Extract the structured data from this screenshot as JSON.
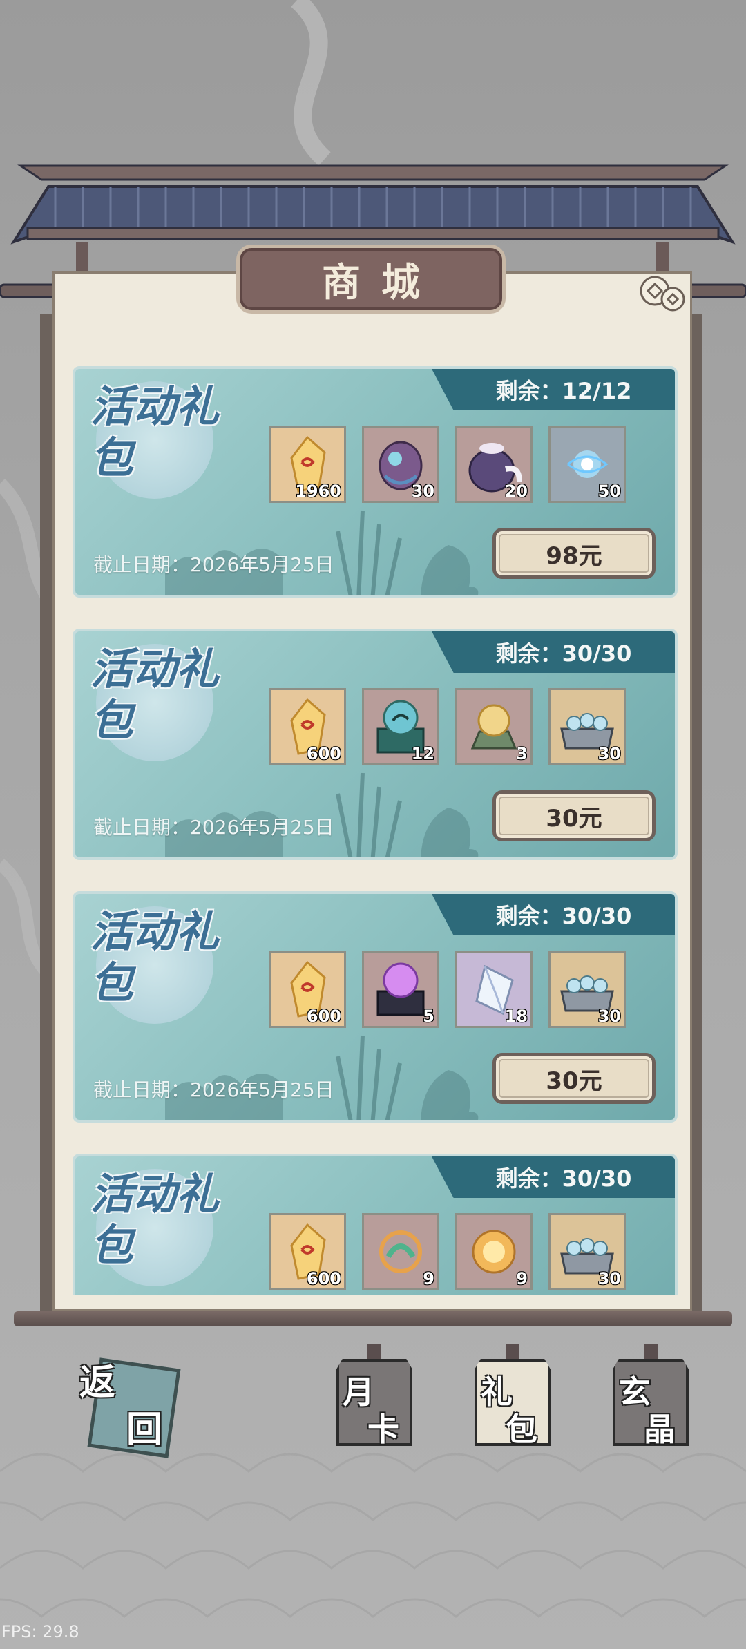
{
  "header": {
    "title": "商城"
  },
  "badge_label": "活动礼包",
  "packs": [
    {
      "remaining": "剩余：12/12",
      "deadline": "截止日期：2026年5月25日",
      "price": "98元",
      "items": [
        {
          "icon": "gold-crystal-icon",
          "count": "1960"
        },
        {
          "icon": "purple-mount-icon",
          "count": "30"
        },
        {
          "icon": "purple-jar-icon",
          "count": "20"
        },
        {
          "icon": "blue-spirit-orb-icon",
          "count": "50"
        }
      ]
    },
    {
      "remaining": "剩余：30/30",
      "deadline": "截止日期：2026年5月25日",
      "price": "30元",
      "items": [
        {
          "icon": "gold-crystal-icon",
          "count": "600"
        },
        {
          "icon": "teal-chest-icon",
          "count": "12"
        },
        {
          "icon": "golden-orb-icon",
          "count": "3"
        },
        {
          "icon": "bead-tray-icon",
          "count": "30"
        }
      ]
    },
    {
      "remaining": "剩余：30/30",
      "deadline": "截止日期：2026年5月25日",
      "price": "30元",
      "items": [
        {
          "icon": "gold-crystal-icon",
          "count": "600"
        },
        {
          "icon": "purple-chest-icon",
          "count": "5"
        },
        {
          "icon": "white-crystal-icon",
          "count": "18"
        },
        {
          "icon": "bead-tray-icon",
          "count": "30"
        }
      ]
    },
    {
      "remaining": "剩余：30/30",
      "deadline": "",
      "price": "",
      "items": [
        {
          "icon": "gold-crystal-icon",
          "count": "600"
        },
        {
          "icon": "jade-dragon-icon",
          "count": "9"
        },
        {
          "icon": "sun-disc-icon",
          "count": "9"
        },
        {
          "icon": "bead-tray-icon",
          "count": "30"
        }
      ]
    }
  ],
  "nav": {
    "back": {
      "c1": "返",
      "c2": "回"
    },
    "tabs": [
      {
        "c1": "月",
        "c2": "卡",
        "active": false
      },
      {
        "c1": "礼",
        "c2": "包",
        "active": true
      },
      {
        "c1": "玄",
        "c2": "晶",
        "active": false
      }
    ]
  },
  "fps": "FPS: 29.8",
  "colors": {
    "card_teal": "#8cc0c0",
    "remain_bar": "#2d6a7a",
    "price_button": "#e8ddc7",
    "paper": "#efeadd",
    "plaque": "#7e6461"
  }
}
